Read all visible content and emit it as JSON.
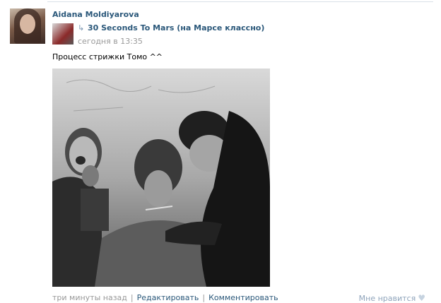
{
  "post": {
    "author": "Aidana Moldiyarova",
    "text": "Процесс стрижки Томо ^^"
  },
  "repost": {
    "icon": "repost-arrow-icon",
    "group": "30 Seconds To Mars (на Марсе классно)",
    "time": "сегодня в 13:35"
  },
  "footer": {
    "time": "три минуты назад",
    "edit": "Редактировать",
    "comment": "Комментировать",
    "like": "Мне нравится",
    "like_icon": "heart-icon"
  },
  "colors": {
    "link": "#2b587a",
    "muted": "#999999"
  }
}
